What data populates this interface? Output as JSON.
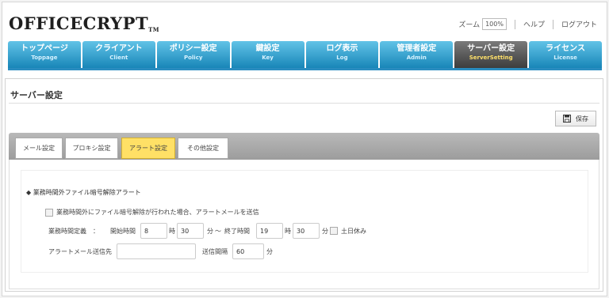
{
  "header": {
    "logo_text": "OFFICECRYPT",
    "logo_mark": "TM",
    "zoom_label": "ズーム",
    "zoom_value": "100%",
    "help_label": "ヘルプ",
    "logout_label": "ログアウト"
  },
  "nav": [
    {
      "jp": "トップページ",
      "en": "Toppage"
    },
    {
      "jp": "クライアント",
      "en": "Client"
    },
    {
      "jp": "ポリシー設定",
      "en": "Policy"
    },
    {
      "jp": "鍵設定",
      "en": "Key"
    },
    {
      "jp": "ログ表示",
      "en": "Log"
    },
    {
      "jp": "管理者設定",
      "en": "Admin"
    },
    {
      "jp": "サーバー設定",
      "en": "ServerSetting",
      "active": true
    },
    {
      "jp": "ライセンス",
      "en": "License"
    }
  ],
  "page": {
    "title": "サーバー設定",
    "save_label": "保存"
  },
  "tabs": [
    {
      "label": "メール設定"
    },
    {
      "label": "プロキシ設定"
    },
    {
      "label": "アラート設定",
      "active": true
    },
    {
      "label": "その他設定"
    }
  ],
  "alert": {
    "section_title": "◆ 業務時間外ファイル暗号解除アラート",
    "send_checkbox_label": "業務時間外にファイル暗号解除が行われた場合、アラートメールを送信",
    "business_hours_label": "業務時間定義　：",
    "start_label": "開始時間",
    "start_hour": "8",
    "hour_unit": "時",
    "start_minute": "30",
    "minute_unit": "分",
    "range_sep": "〜",
    "end_label": "終了時間",
    "end_hour": "19",
    "end_minute": "30",
    "weekend_label": "土日休み",
    "recipient_label": "アラートメール送信先",
    "recipient_value": "",
    "interval_label": "送信間隔",
    "interval_value": "60",
    "interval_unit": "分"
  },
  "colors": {
    "nav": "#1886b8",
    "nav_active": "#3d3d3d",
    "tab_active": "#ffe066"
  }
}
